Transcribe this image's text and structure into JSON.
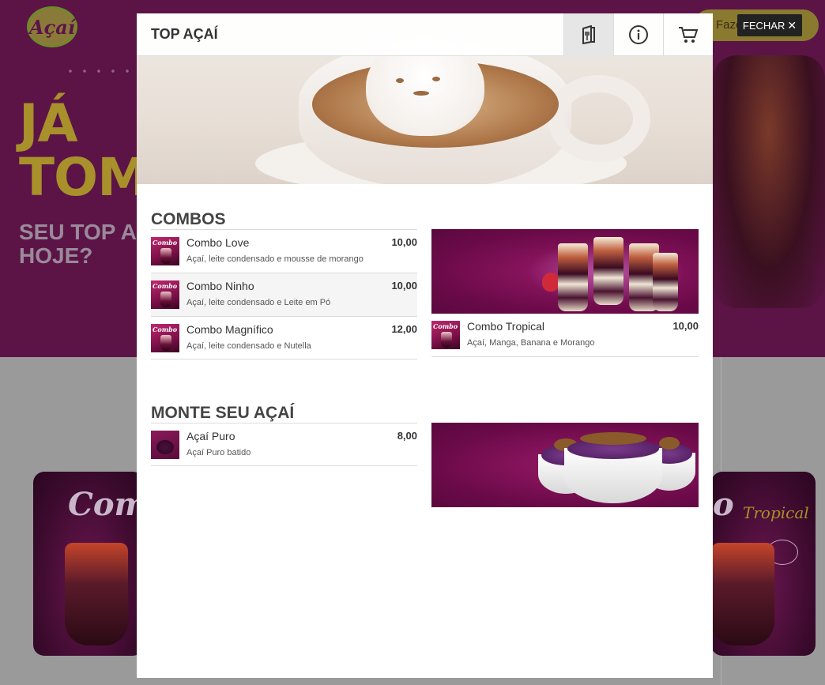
{
  "background": {
    "logo_text": "Açaí",
    "hero_line1": "JÁ",
    "hero_line2": "TOM",
    "hero_sub1": "SEU TOP A",
    "hero_sub2": "HOJE?",
    "order_button_partial": "Faze",
    "banner_left_script": "Combo",
    "banner_right_script": "bo",
    "banner_right_subscript": "Tropical"
  },
  "close_button": {
    "label": "FECHAR",
    "icon": "close-icon"
  },
  "modal": {
    "title": "TOP AÇAÍ",
    "toolbar": [
      {
        "icon": "menu-book-icon",
        "active": true
      },
      {
        "icon": "info-icon",
        "active": false
      },
      {
        "icon": "cart-icon",
        "active": false
      }
    ],
    "sections": [
      {
        "title": "COMBOS",
        "items": [
          {
            "name": "Combo Love",
            "description": "Açaí, leite condensado e mousse de morango",
            "price": "10,00",
            "thumb_label": "Combo"
          },
          {
            "name": "Combo Ninho",
            "description": "Açaí, leite condensado e Leite em Pó",
            "price": "10,00",
            "thumb_label": "Combo"
          },
          {
            "name": "Combo Magnífico",
            "description": "Açaí, leite condensado e Nutella",
            "price": "12,00",
            "thumb_label": "Combo"
          }
        ],
        "right_items": [
          {
            "name": "Combo Tropical",
            "description": "Açaí, Manga, Banana e Morango",
            "price": "10,00",
            "thumb_label": "Combo"
          }
        ]
      },
      {
        "title": "MONTE SEU AÇAÍ",
        "items": [
          {
            "name": "Açaí Puro",
            "description": "Açaí Puro batido",
            "price": "8,00"
          }
        ]
      }
    ]
  }
}
